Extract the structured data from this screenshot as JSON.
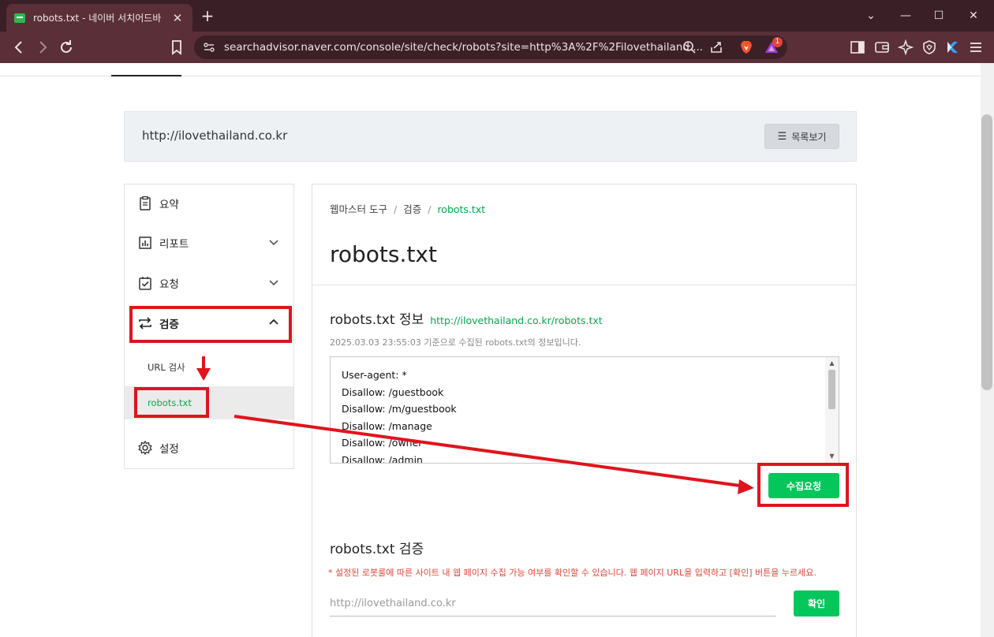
{
  "browser": {
    "tab_title": "robots.txt - 네이버 서치어드바",
    "tab_close": "✕",
    "new_tab": "+",
    "url": "searchadvisor.naver.com/console/site/check/robots?site=http%3A%2F%2Filovethailand....",
    "rewards_badge": "1",
    "icons": [
      "back-icon",
      "forward-icon",
      "reload-icon",
      "bookmark-icon",
      "site-info-icon",
      "zoom-icon",
      "share-icon",
      "brave-shield-icon",
      "brave-rewards-icon",
      "sidebar-icon",
      "wallet-icon",
      "leo-ai-icon",
      "vpn-icon",
      "extension-icon",
      "menu-icon"
    ],
    "window_controls": {
      "chevron": "⌄",
      "minimize": "—",
      "maximize": "☐",
      "close": "✕"
    }
  },
  "site_bar": {
    "url": "http://ilovethailand.co.kr",
    "list_button": "목록보기"
  },
  "sidebar": {
    "items": [
      {
        "label": "요약",
        "icon": "clipboard-icon"
      },
      {
        "label": "리포트",
        "icon": "chart-icon",
        "expandable": true
      },
      {
        "label": "요청",
        "icon": "checklist-icon",
        "expandable": true
      },
      {
        "label": "검증",
        "icon": "swap-arrows-icon",
        "expanded": true,
        "active": true
      },
      {
        "label": "설정",
        "icon": "gear-icon"
      }
    ],
    "sub_items": [
      {
        "label": "URL 검사",
        "active": false
      },
      {
        "label": "robots.txt",
        "active": true
      }
    ]
  },
  "main": {
    "breadcrumb": [
      "웹마스터 도구",
      "검증",
      "robots.txt"
    ],
    "breadcrumb_sep": "/",
    "title": "robots.txt",
    "info": {
      "title": "robots.txt 정보",
      "link": "http://ilovethailand.co.kr/robots.txt",
      "desc": "2025.03.03 23:55:03 기준으로 수집된 robots.txt의 정보입니다.",
      "lines": [
        "User-agent: *",
        "Disallow: /guestbook",
        "Disallow: /m/guestbook",
        "Disallow: /manage",
        "Disallow: /owner",
        "Disallow: /admin"
      ],
      "collect_button": "수집요청"
    },
    "verify": {
      "title": "robots.txt 검증",
      "warning": "* 설정된 로봇룰에 따른 사이트 내 웹 페이지 수집 가능 여부를 확인할 수 있습니다. 웹 페이지 URL을 입력하고 [확인] 버튼을 누르세요.",
      "input_placeholder": "http://ilovethailand.co.kr",
      "confirm_button": "확인"
    }
  },
  "colors": {
    "accent": "#03c75a",
    "link_green": "#03a94d",
    "annotation_red": "#e0141c",
    "warning": "#e0453a"
  }
}
